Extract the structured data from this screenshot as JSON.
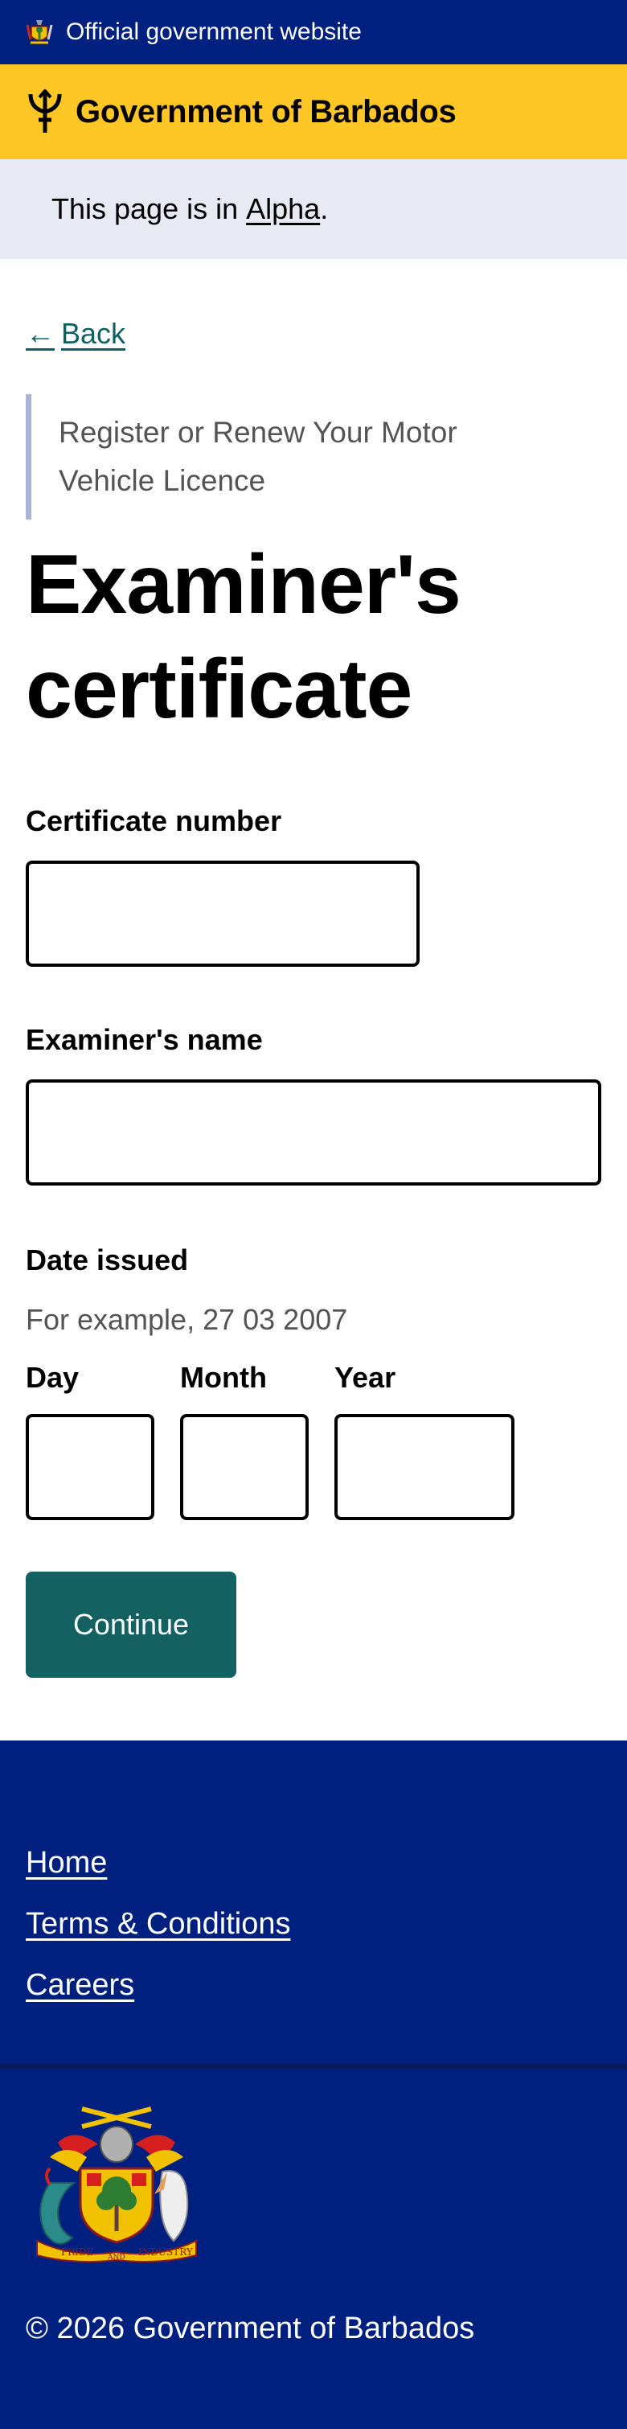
{
  "official_bar": {
    "text": "Official government website",
    "icon": "coat-of-arms-icon"
  },
  "header": {
    "title": "Government of Barbados",
    "icon": "trident-icon"
  },
  "phase_banner": {
    "prefix": "This page is in ",
    "phase": "Alpha",
    "suffix": "."
  },
  "back_link": {
    "arrow": "←",
    "label": "Back"
  },
  "caption": "Register or Renew Your Motor Vehicle Licence",
  "title": "Examiner's certificate",
  "fields": {
    "certificate_number": {
      "label": "Certificate number",
      "value": ""
    },
    "examiner_name": {
      "label": "Examiner's name",
      "value": ""
    }
  },
  "date_issued": {
    "label": "Date issued",
    "hint": "For example, 27 03 2007",
    "day_label": "Day",
    "month_label": "Month",
    "year_label": "Year"
  },
  "continue_label": "Continue",
  "footer": {
    "links": [
      "Home",
      "Terms & Conditions",
      "Careers"
    ],
    "copyright": "© 2026 Government of Barbados",
    "motto": [
      "PRIDE",
      "AND",
      "INDUSTRY"
    ]
  },
  "colors": {
    "official_bar": "#00207f",
    "header": "#ffc726",
    "phase_banner": "#e7eaf3",
    "button": "#136161",
    "link": "#0f6060",
    "footer": "#00207f"
  }
}
